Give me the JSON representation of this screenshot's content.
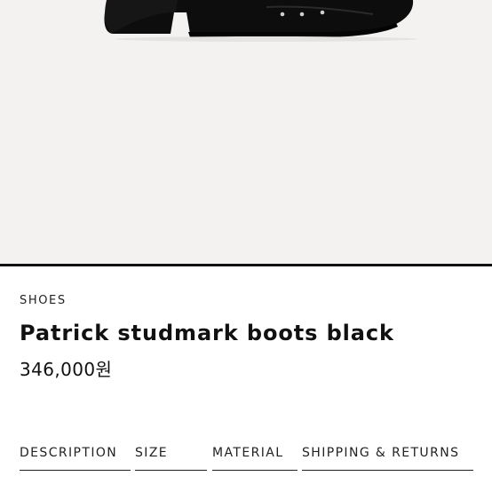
{
  "product": {
    "category": "SHOES",
    "name": "Patrick studmark boots black",
    "price": "346,000원"
  },
  "tabs": [
    {
      "label": "DESCRIPTION"
    },
    {
      "label": "SIZE"
    },
    {
      "label": "MATERIAL"
    },
    {
      "label": "SHIPPING & RETURNS"
    }
  ],
  "colors": {
    "hero_background": "#f3f2f0",
    "text": "#111111",
    "boot": "#0d0d0d"
  }
}
